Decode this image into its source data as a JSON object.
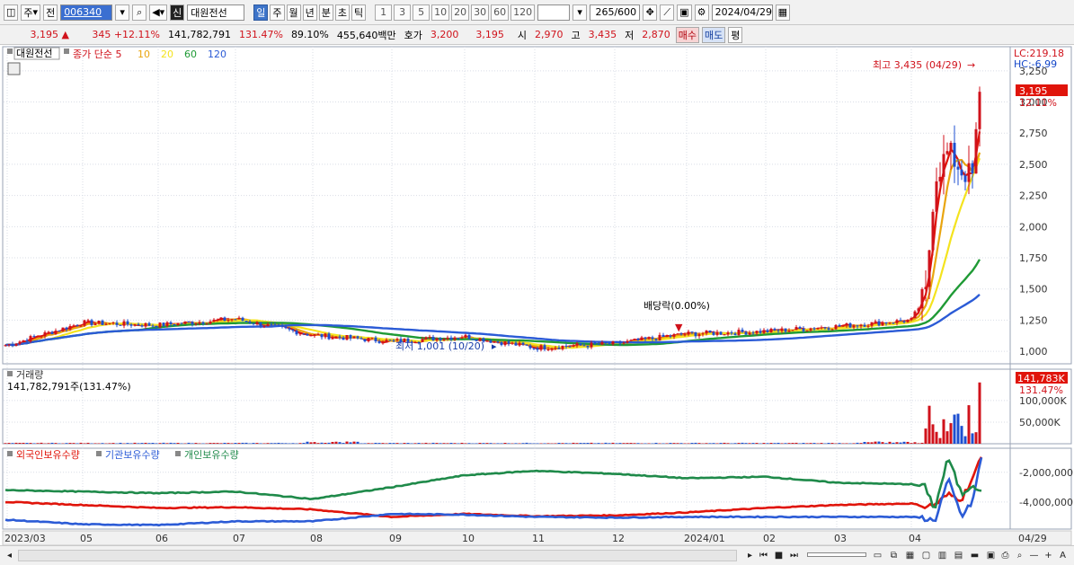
{
  "toolbar": {
    "type_label": "주",
    "all_label": "전",
    "code": "006340",
    "new_badge": "신",
    "name": "대원전선",
    "periods": [
      "일",
      "주",
      "월",
      "년",
      "분",
      "초",
      "틱"
    ],
    "active_period": "일",
    "minutes": [
      "1",
      "3",
      "5",
      "10",
      "20",
      "30",
      "60",
      "120"
    ],
    "count": "265",
    "count_total": "/600",
    "date": "2024/04/29"
  },
  "quote": {
    "price": "3,195",
    "change_sign": "▲",
    "change": "345",
    "change_pct": "+12.11%",
    "volume": "141,782,791",
    "volume_ratio": "131.47%",
    "rate2": "89.10%",
    "amount": "455,640백만",
    "hoga_label": "호가",
    "ask": "3,200",
    "bid": "3,195",
    "open_label": "시",
    "open": "2,970",
    "high_label": "고",
    "high": "3,435",
    "low_label": "저",
    "low": "2,870",
    "buy_label": "매수",
    "sell_label": "매도",
    "eval_label": "평"
  },
  "price_panel": {
    "stock_tag": "대원전선",
    "ma_label": "종가 단순",
    "ma_periods": [
      "5",
      "10",
      "20",
      "60",
      "120"
    ],
    "ma_colors": [
      "#e0140a",
      "#e9a50f",
      "#f4e31e",
      "#1f9a35",
      "#2b5bd6"
    ],
    "lc": "LC:219.18",
    "hc": "HC:-6.99",
    "high_annotation": "최고 3,435 (04/29)",
    "low_annotation": "최저 1,001 (10/20)",
    "dividend_annotation": "배당락(0.00%)",
    "current_price": "3,195",
    "current_pct": "12.11%",
    "y_ticks": [
      "3,250",
      "3,000",
      "2,750",
      "2,500",
      "2,250",
      "2,000",
      "1,750",
      "1,500",
      "1,250",
      "1,000"
    ]
  },
  "volume_panel": {
    "title": "거래량",
    "value": "141,782,791주(131.47%)",
    "current": "141,783K",
    "current_pct": "131.47%",
    "y_ticks": [
      "100,000K",
      "50,000K"
    ]
  },
  "holdings_panel": {
    "series": [
      {
        "name": "외국인보유수량",
        "color": "#e0140a"
      },
      {
        "name": "기관보유수량",
        "color": "#2b5bd6"
      },
      {
        "name": "개인보유수량",
        "color": "#1f8a4a"
      }
    ],
    "y_ticks": [
      "-2,000,000",
      "-4,000,000"
    ]
  },
  "x_axis": {
    "labels": [
      "2023/03",
      "05",
      "06",
      "07",
      "08",
      "09",
      "10",
      "11",
      "12",
      "2024/01",
      "02",
      "03",
      "04"
    ],
    "right_label": "04/29"
  },
  "chart_data": {
    "type": "line",
    "x": [
      "2023-03",
      "2023-04",
      "2023-05",
      "2023-06",
      "2023-07",
      "2023-08",
      "2023-09",
      "2023-10",
      "2023-11",
      "2023-12",
      "2024-01",
      "2024-02",
      "2024-03",
      "2024-04-01",
      "2024-04-10",
      "2024-04-15",
      "2024-04-20",
      "2024-04-25",
      "2024-04-29"
    ],
    "series": [
      {
        "name": "종가",
        "values": [
          1050,
          1230,
          1210,
          1260,
          1130,
          1080,
          1120,
          1030,
          1060,
          1140,
          1160,
          1200,
          1250,
          1450,
          2400,
          2600,
          2450,
          2400,
          3195
        ]
      },
      {
        "name": "외국인보유수량",
        "values": [
          -4000000,
          -4200000,
          -4400000,
          -4350000,
          -4500000,
          -5000000,
          -4800000,
          -4950000,
          -4900000,
          -4700000,
          -4400000,
          -4200000,
          -4100000,
          -4300000,
          -4200000,
          -3500000,
          -3800000,
          -2400000,
          -1000000
        ]
      },
      {
        "name": "기관보유수량",
        "values": [
          -5200000,
          -5500000,
          -5550000,
          -5300000,
          -5300000,
          -4800000,
          -4850000,
          -5000000,
          -5050000,
          -5000000,
          -5000000,
          -5000000,
          -5000000,
          -5100000,
          -5300000,
          -2500000,
          -5000000,
          -4000000,
          -1000000
        ]
      },
      {
        "name": "개인보유수량",
        "values": [
          -3200000,
          -3300000,
          -3400000,
          -3300000,
          -3800000,
          -3000000,
          -2200000,
          -1900000,
          -2100000,
          -2400000,
          -2300000,
          -2700000,
          -2800000,
          -3000000,
          -4500000,
          -1000000,
          -3500000,
          -2800000,
          -3200000
        ]
      }
    ],
    "ylim": [
      1000,
      3435
    ],
    "high": 3435,
    "low": 1001,
    "last": 3195,
    "volume": {
      "unit": "K",
      "last": 141783,
      "ticks": [
        50000,
        100000
      ]
    },
    "grid": true
  },
  "bottom_bar": {
    "zoom_out": "—",
    "zoom_in": "+",
    "font_label": "A"
  }
}
